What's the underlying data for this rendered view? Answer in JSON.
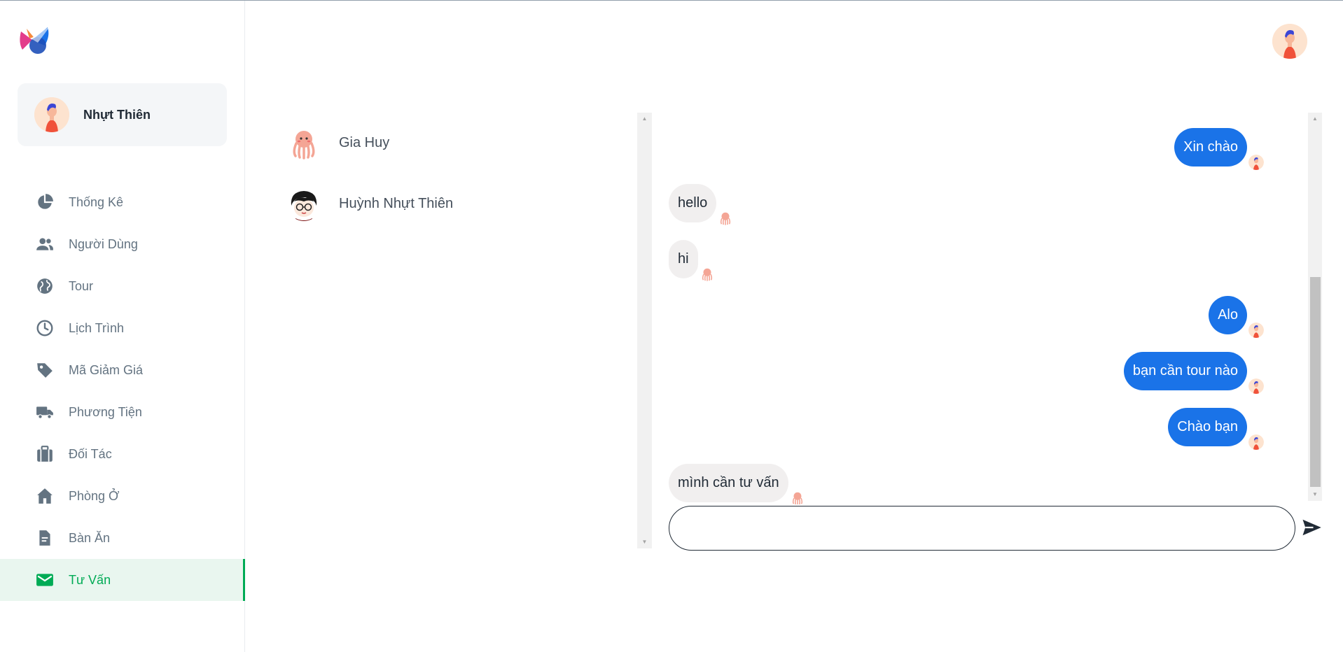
{
  "user": {
    "name": "Nhựt Thiên"
  },
  "nav": [
    {
      "label": "Thống Kê",
      "icon": "pie-chart-icon"
    },
    {
      "label": "Người Dùng",
      "icon": "users-icon"
    },
    {
      "label": "Tour",
      "icon": "globe-icon"
    },
    {
      "label": "Lịch Trình",
      "icon": "clock-icon"
    },
    {
      "label": "Mã Giảm Giá",
      "icon": "tag-icon"
    },
    {
      "label": "Phương Tiện",
      "icon": "truck-icon"
    },
    {
      "label": "Đối Tác",
      "icon": "briefcase-icon"
    },
    {
      "label": "Phòng Ở",
      "icon": "home-icon"
    },
    {
      "label": "Bàn Ăn",
      "icon": "document-icon"
    },
    {
      "label": "Tư Vấn",
      "icon": "mail-icon",
      "active": true
    }
  ],
  "contacts": [
    {
      "name": "Gia Huy"
    },
    {
      "name": "Huỳnh Nhựt Thiên"
    }
  ],
  "messages": [
    {
      "text": "Xin chào",
      "direction": "out"
    },
    {
      "text": "hello",
      "direction": "in"
    },
    {
      "text": "hi",
      "direction": "in"
    },
    {
      "text": "Alo",
      "direction": "out"
    },
    {
      "text": "bạn cần tour nào",
      "direction": "out"
    },
    {
      "text": "Chào bạn",
      "direction": "out"
    },
    {
      "text": "mình cần tư vấn",
      "direction": "in"
    }
  ],
  "composer": {
    "value": "",
    "placeholder": ""
  },
  "colors": {
    "accent": "#00ab55",
    "outgoing": "#1a73e8",
    "incoming": "#f1efef"
  }
}
